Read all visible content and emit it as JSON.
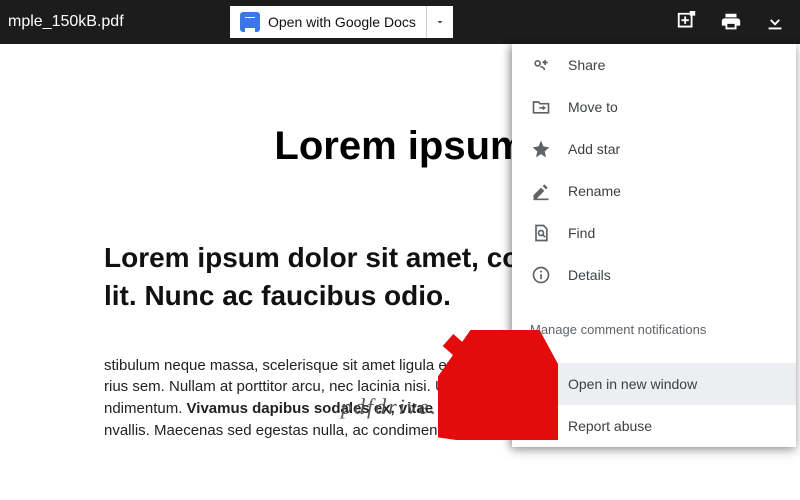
{
  "toolbar": {
    "filename": "mple_150kB.pdf",
    "openWithLabel": "Open with Google Docs"
  },
  "document": {
    "title": "Lorem ipsum",
    "subtitle_line1": "Lorem ipsum dolor sit amet, consecte",
    "subtitle_line2": "lit. Nunc ac faucibus odio.",
    "body_plain1": "stibulum neque massa, scelerisque sit amet ligula eu, congu",
    "body_plain2": "rius sem. Nullam at porttitor arcu, nec lacinia nisi. Ut ac",
    "body_plain3": "ndimentum. ",
    "body_bold": "Vivamus dapibus sodales ex, vitae ma",
    "body_plain4": "nvallis. Maecenas sed egestas nulla, ac condimentum o"
  },
  "watermark": "pdfdrive.to",
  "menu": {
    "items": [
      {
        "icon": "share-icon",
        "label": "Share"
      },
      {
        "icon": "move-icon",
        "label": "Move to"
      },
      {
        "icon": "star-icon",
        "label": "Add star"
      },
      {
        "icon": "rename-icon",
        "label": "Rename"
      },
      {
        "icon": "find-icon",
        "label": "Find"
      },
      {
        "icon": "details-icon",
        "label": "Details"
      }
    ],
    "manageComments": "Manage comment notifications",
    "openNewWindow": "Open in new window",
    "reportAbuse": "Report abuse"
  }
}
